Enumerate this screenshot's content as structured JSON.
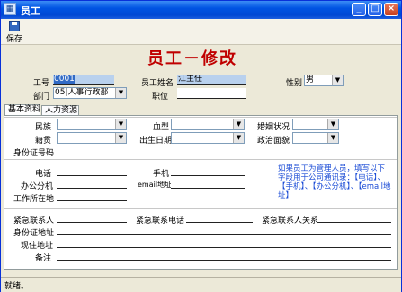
{
  "window": {
    "title": "员工"
  },
  "toolbar": {
    "save_label": "保存"
  },
  "header": {
    "title": "员工－修改"
  },
  "top": {
    "emp_no_label": "工号",
    "emp_no_value": "0001",
    "emp_name_label": "员工姓名",
    "emp_name_value": "江主任",
    "gender_label": "性别",
    "gender_value": "男",
    "dept_label": "部门",
    "dept_value": "05|人事行政部",
    "position_label": "职位",
    "position_value": ""
  },
  "tabs": [
    {
      "label": "基本资料"
    },
    {
      "label": "人力资源"
    }
  ],
  "basic": {
    "ethnicity_label": "民族",
    "blood_label": "血型",
    "marital_label": "婚姻状况",
    "native_label": "籍贯",
    "birth_label": "出生日期",
    "political_label": "政治面貌",
    "idcard_label": "身份证号码",
    "phone_label": "电话",
    "mobile_label": "手机",
    "ext_label": "办公分机",
    "email_label": "email地址",
    "workplace_label": "工作所在地",
    "note": "如果员工为管理人员，填写以下字段用于公司通讯录：【电话】、【手机】、【办公分机】、【email地址】",
    "emergency_contact_label": "紧急联系人",
    "emergency_phone_label": "紧急联系电话",
    "emergency_relation_label": "紧急联系人关系",
    "id_address_label": "身份证地址",
    "current_address_label": "现住地址",
    "remarks_label": "备注"
  },
  "status": {
    "text": "就绪。"
  },
  "colors": {
    "title_red": "#c00000",
    "note_blue": "#1a4bd6",
    "titlebar_blue": "#0054e3",
    "selection": "#316ac5"
  }
}
